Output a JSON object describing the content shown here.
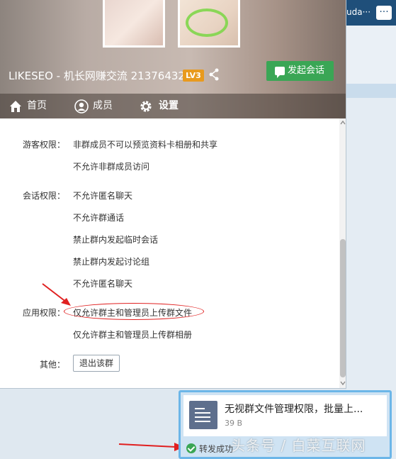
{
  "background": {
    "right_panel_text": "uda···",
    "right_panel_more": "···"
  },
  "header": {
    "group_title": "LIKESEO - 机长网赚交流 21376432",
    "level_badge": "LV3",
    "start_chat_label": "发起会话"
  },
  "tabs": [
    {
      "label": "首页",
      "icon": "home-icon"
    },
    {
      "label": "成员",
      "icon": "user-icon"
    },
    {
      "label": "设置",
      "icon": "gear-icon"
    }
  ],
  "settings": {
    "guest_label": "游客权限：",
    "guest_items": [
      "非群成员不可以预览资料卡相册和共享",
      "不允许非群成员访问"
    ],
    "chat_label": "会话权限：",
    "chat_items": [
      "不允许匿名聊天",
      "不允许群通话",
      "禁止群内发起临时会话",
      "禁止群内发起讨论组",
      "不允许匿名聊天"
    ],
    "app_label": "应用权限：",
    "app_items": [
      "仅允许群主和管理员上传群文件",
      "仅允许群主和管理员上传群相册"
    ],
    "other_label": "其他：",
    "exit_button": "退出该群"
  },
  "toast": {
    "file_title": "无视群文件管理权限，批量上...",
    "file_size": "39 B",
    "status": "转发成功"
  },
  "watermark": "头条号 / 白菜互联网",
  "colors": {
    "accent_green": "#3aa655",
    "badge_orange": "#e89a1e",
    "annotation_red": "#e02020",
    "toast_border": "#6cb6e8"
  }
}
